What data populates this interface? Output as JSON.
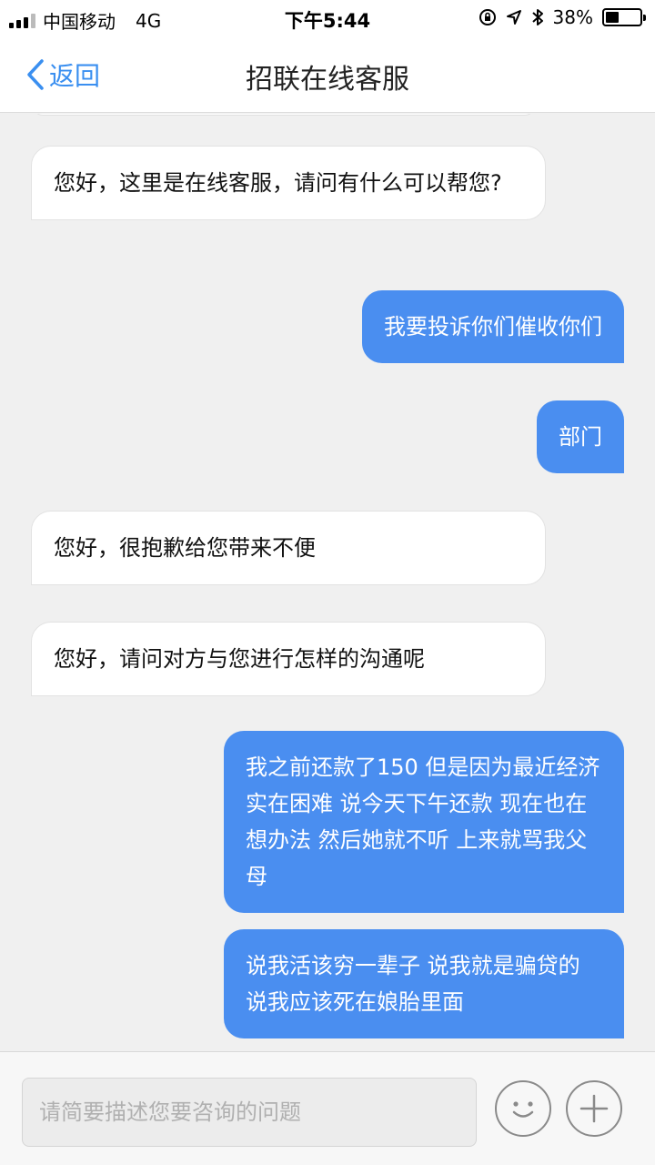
{
  "status_bar": {
    "carrier": "中国移动",
    "network": "4G",
    "time": "下午5:44",
    "battery_percent": "38%",
    "battery_level": 0.38
  },
  "nav": {
    "back_label": "返回",
    "title": "招联在线客服"
  },
  "messages": [
    {
      "side": "left",
      "text": "您好，这里是在线客服，请问有什么可以帮您?"
    },
    {
      "side": "right",
      "text": "我要投诉你们催收你们"
    },
    {
      "side": "right",
      "text": "部门"
    },
    {
      "side": "left",
      "text": "您好，很抱歉给您带来不便"
    },
    {
      "side": "left",
      "text": "您好，请问对方与您进行怎样的沟通呢"
    },
    {
      "side": "right",
      "text": "我之前还款了150 但是因为最近经济实在困难 说今天下午还款 现在也在想办法 然后她就不听 上来就骂我父母"
    },
    {
      "side": "right",
      "text": "说我活该穷一辈子 说我就是骗贷的 说我应该死在娘胎里面"
    }
  ],
  "input": {
    "placeholder": "请简要描述您要咨询的问题"
  },
  "icons": {
    "emoji": "smiley-icon",
    "plus": "plus-icon",
    "back": "chevron-left-icon"
  },
  "colors": {
    "accent": "#4a8ef0",
    "back_link": "#3a8ff0"
  }
}
